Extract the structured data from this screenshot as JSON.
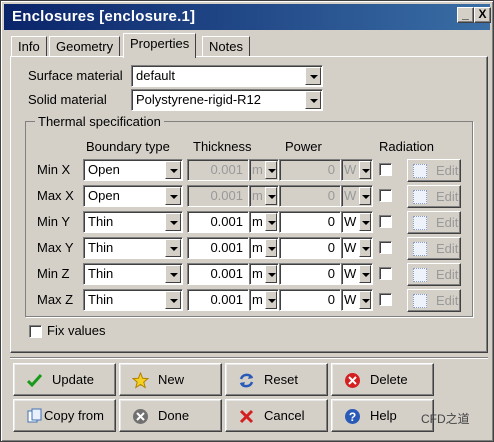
{
  "window": {
    "title": "Enclosures [enclosure.1]",
    "minimize_label": "_",
    "close_label": "X"
  },
  "tabs": [
    {
      "label": "Info"
    },
    {
      "label": "Geometry"
    },
    {
      "label": "Properties",
      "active": true
    },
    {
      "label": "Notes"
    }
  ],
  "materials": {
    "surface_label": "Surface material",
    "surface_value": "default",
    "solid_label": "Solid material",
    "solid_value": "Polystyrene-rigid-R12"
  },
  "thermal": {
    "group_label": "Thermal specification",
    "headers": {
      "boundary": "Boundary type",
      "thickness": "Thickness",
      "power": "Power",
      "radiation": "Radiation"
    },
    "rows": [
      {
        "label": "Min X",
        "boundary": "Open",
        "thickness": "0.001",
        "thickness_unit": "m",
        "power": "0",
        "power_unit": "W",
        "edit": "Edit",
        "disabled": true
      },
      {
        "label": "Max X",
        "boundary": "Open",
        "thickness": "0.001",
        "thickness_unit": "m",
        "power": "0",
        "power_unit": "W",
        "edit": "Edit",
        "disabled": true
      },
      {
        "label": "Min Y",
        "boundary": "Thin",
        "thickness": "0.001",
        "thickness_unit": "m",
        "power": "0",
        "power_unit": "W",
        "edit": "Edit",
        "disabled": false
      },
      {
        "label": "Max Y",
        "boundary": "Thin",
        "thickness": "0.001",
        "thickness_unit": "m",
        "power": "0",
        "power_unit": "W",
        "edit": "Edit",
        "disabled": false
      },
      {
        "label": "Min Z",
        "boundary": "Thin",
        "thickness": "0.001",
        "thickness_unit": "m",
        "power": "0",
        "power_unit": "W",
        "edit": "Edit",
        "disabled": false
      },
      {
        "label": "Max Z",
        "boundary": "Thin",
        "thickness": "0.001",
        "thickness_unit": "m",
        "power": "0",
        "power_unit": "W",
        "edit": "Edit",
        "disabled": false
      }
    ]
  },
  "fix_values_label": "Fix values",
  "buttons": {
    "update": "Update",
    "new": "New",
    "reset": "Reset",
    "delete": "Delete",
    "copy_from": "Copy from",
    "done": "Done",
    "cancel": "Cancel",
    "help": "Help"
  },
  "watermark": "CFD之道",
  "colors": {
    "title_start": "#0a246a",
    "title_end": "#3a6ea5",
    "face": "#d4d0c8"
  }
}
